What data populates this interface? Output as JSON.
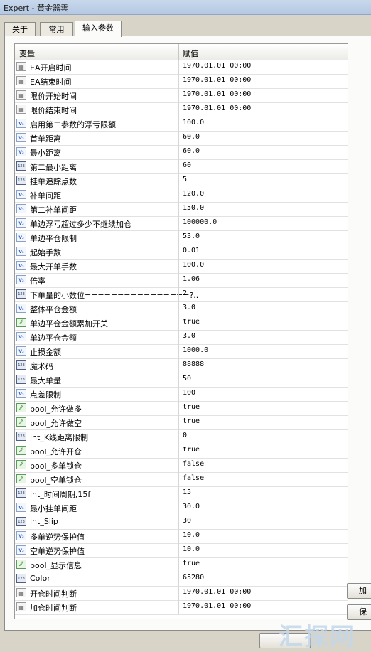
{
  "window": {
    "title": "Expert - 黃金器雲"
  },
  "tabs": [
    {
      "label": "关于"
    },
    {
      "label": "常用"
    },
    {
      "label": "输入参数"
    }
  ],
  "grid": {
    "headers": {
      "variable": "变量",
      "value": "赋值"
    },
    "rows": [
      {
        "icon": "dt",
        "name": "EA开启时间",
        "value": "1970.01.01 00:00"
      },
      {
        "icon": "dt",
        "name": "EA结束时间",
        "value": "1970.01.01 00:00"
      },
      {
        "icon": "dt",
        "name": "限价开始时间",
        "value": "1970.01.01 00:00"
      },
      {
        "icon": "dt",
        "name": "限价结束时间",
        "value": "1970.01.01 00:00"
      },
      {
        "icon": "dbl",
        "name": "启用第二参数的浮亏限额",
        "value": "100.0"
      },
      {
        "icon": "dbl",
        "name": "首单距离",
        "value": "60.0"
      },
      {
        "icon": "dbl",
        "name": "最小距离",
        "value": "60.0"
      },
      {
        "icon": "int",
        "name": "第二最小距离",
        "value": "60"
      },
      {
        "icon": "int",
        "name": "挂单追踪点数",
        "value": "5"
      },
      {
        "icon": "dbl",
        "name": "补单间距",
        "value": "120.0"
      },
      {
        "icon": "dbl",
        "name": "第二补单间距",
        "value": "150.0"
      },
      {
        "icon": "dbl",
        "name": "单边浮亏超过多少不继续加仓",
        "value": "100000.0"
      },
      {
        "icon": "dbl",
        "name": "单边平仓限制",
        "value": "53.0"
      },
      {
        "icon": "dbl",
        "name": "起始手数",
        "value": "0.01"
      },
      {
        "icon": "dbl",
        "name": "最大开单手数",
        "value": "100.0"
      },
      {
        "icon": "dbl",
        "name": "倍率",
        "value": "1.06"
      },
      {
        "icon": "int",
        "name": "下单量的小数位================?..",
        "value": "2"
      },
      {
        "icon": "dbl",
        "name": "整体平仓金额",
        "value": "3.0"
      },
      {
        "icon": "bool",
        "name": "单边平仓金额累加开关",
        "value": "true"
      },
      {
        "icon": "dbl",
        "name": "单边平仓金额",
        "value": "3.0"
      },
      {
        "icon": "dbl",
        "name": "止损金额",
        "value": "1000.0"
      },
      {
        "icon": "int",
        "name": "魔术码",
        "value": "88888"
      },
      {
        "icon": "int",
        "name": "最大单量",
        "value": "50"
      },
      {
        "icon": "dbl",
        "name": "点差限制",
        "value": "100"
      },
      {
        "icon": "bool",
        "name": "bool_允许做多",
        "value": "true"
      },
      {
        "icon": "bool",
        "name": "bool_允许做空",
        "value": "true"
      },
      {
        "icon": "int",
        "name": "int_K线距离限制",
        "value": "0"
      },
      {
        "icon": "bool",
        "name": "bool_允许开仓",
        "value": "true"
      },
      {
        "icon": "bool",
        "name": "bool_多单锁仓",
        "value": "false"
      },
      {
        "icon": "bool",
        "name": "bool_空单锁仓",
        "value": "false"
      },
      {
        "icon": "int",
        "name": "int_时间周期,15f",
        "value": "15"
      },
      {
        "icon": "dbl",
        "name": "最小挂单间距",
        "value": "30.0"
      },
      {
        "icon": "int",
        "name": "int_Slip",
        "value": "30"
      },
      {
        "icon": "dbl",
        "name": "多单逆势保护值",
        "value": "10.0"
      },
      {
        "icon": "dbl",
        "name": "空单逆势保护值",
        "value": "10.0"
      },
      {
        "icon": "bool",
        "name": "bool_显示信息",
        "value": "true"
      },
      {
        "icon": "int",
        "name": "Color",
        "value": "65280"
      },
      {
        "icon": "dt",
        "name": "开仓时间判断",
        "value": "1970.01.01 00:00"
      },
      {
        "icon": "dt",
        "name": "加仓时间判断",
        "value": "1970.01.01 00:00"
      }
    ]
  },
  "side_buttons": [
    {
      "label": "加"
    },
    {
      "label": "保"
    }
  ],
  "watermark": {
    "text": "汇探网"
  },
  "icon_glyphs": {
    "dt": "▦",
    "dbl": "V₂",
    "int": "123",
    "bool": "⁄⁄"
  }
}
